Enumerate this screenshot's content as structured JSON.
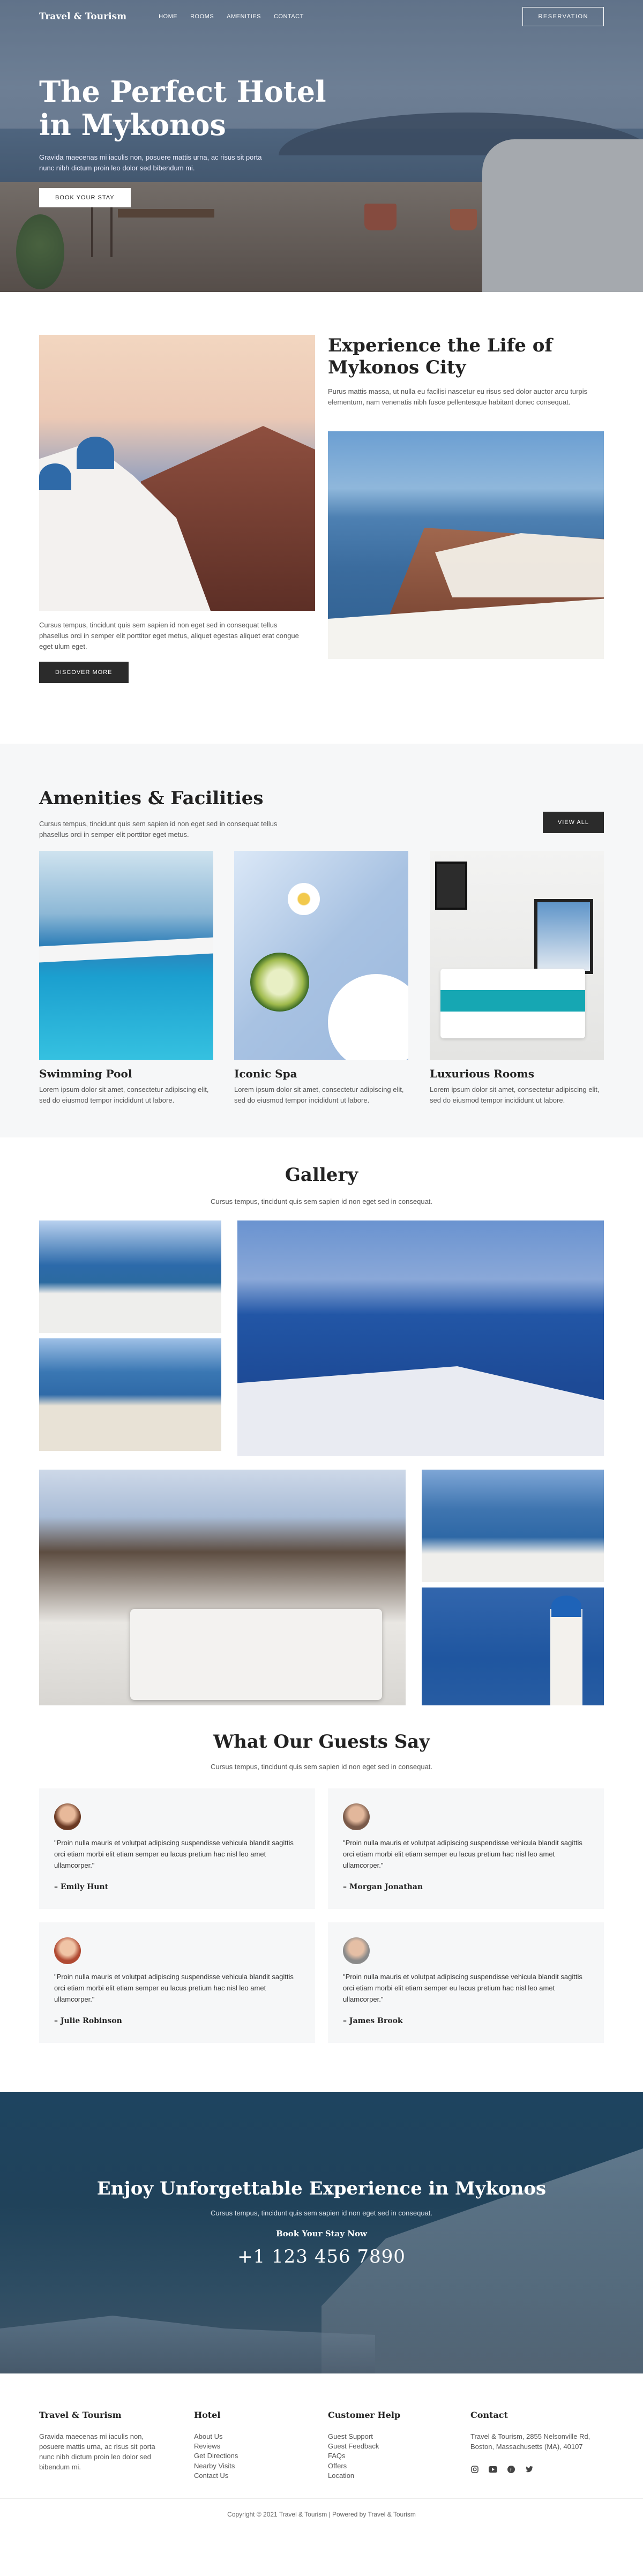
{
  "nav": {
    "logo": "Travel & Tourism",
    "links": [
      "HOME",
      "ROOMS",
      "AMENITIES",
      "CONTACT"
    ],
    "reservation": "RESERVATION"
  },
  "hero": {
    "title": "The Perfect Hotel in Mykonos",
    "text": "Gravida maecenas mi iaculis non, posuere mattis urna, ac risus sit porta nunc nibh dictum proin leo dolor sed bibendum mi.",
    "button": "BOOK YOUR STAY"
  },
  "experience": {
    "title": "Experience the Life of Mykonos City",
    "text": "Purus mattis massa, ut nulla eu facilisi nascetur eu risus sed dolor auctor arcu turpis elementum, nam venenatis nibh fusce pellentesque habitant donec consequat.",
    "text2": "Cursus tempus, tincidunt quis sem sapien id non eget sed in consequat tellus phasellus orci in semper elit porttitor eget metus, aliquet egestas aliquet erat congue eget ulum eget.",
    "button": "DISCOVER MORE"
  },
  "amenities": {
    "title": "Amenities & Facilities",
    "text": "Cursus tempus, tincidunt quis sem sapien id non eget sed in consequat tellus phasellus orci in semper elit porttitor eget metus.",
    "button": "VIEW ALL",
    "items": [
      {
        "title": "Swimming Pool",
        "text": "Lorem ipsum dolor sit amet, consectetur adipiscing elit, sed do eiusmod tempor incididunt ut labore."
      },
      {
        "title": "Iconic Spa",
        "text": "Lorem ipsum dolor sit amet, consectetur adipiscing elit, sed do eiusmod tempor incididunt ut labore."
      },
      {
        "title": "Luxurious Rooms",
        "text": "Lorem ipsum dolor sit amet, consectetur adipiscing elit, sed do eiusmod tempor incididunt ut labore."
      }
    ]
  },
  "gallery": {
    "title": "Gallery",
    "text": "Cursus tempus, tincidunt quis sem sapien id non eget sed in consequat."
  },
  "testimonials": {
    "title": "What Our Guests Say",
    "text": "Cursus tempus, tincidunt quis sem sapien id non eget sed in consequat.",
    "items": [
      {
        "quote": "\"Proin nulla mauris et volutpat adipiscing suspendisse vehicula blandit sagittis orci etiam morbi elit etiam semper eu lacus pretium hac nisl leo amet ullamcorper.\"",
        "name": "– Emily Hunt"
      },
      {
        "quote": "\"Proin nulla mauris et volutpat adipiscing suspendisse vehicula blandit sagittis orci etiam morbi elit etiam semper eu lacus pretium hac nisl leo amet ullamcorper.\"",
        "name": "– Morgan Jonathan"
      },
      {
        "quote": "\"Proin nulla mauris et volutpat adipiscing suspendisse vehicula blandit sagittis orci etiam morbi elit etiam semper eu lacus pretium hac nisl leo amet ullamcorper.\"",
        "name": "– Julie Robinson"
      },
      {
        "quote": "\"Proin nulla mauris et volutpat adipiscing suspendisse vehicula blandit sagittis orci etiam morbi elit etiam semper eu lacus pretium hac nisl leo amet ullamcorper.\"",
        "name": "– James Brook"
      }
    ]
  },
  "cta": {
    "title": "Enjoy Unforgettable Experience in Mykonos",
    "text": "Cursus tempus, tincidunt quis sem sapien id non eget sed in consequat.",
    "book": "Book Your Stay Now",
    "phone": "+1 123 456 7890"
  },
  "footer": {
    "brand": "Travel & Tourism",
    "brand_text": "Gravida maecenas mi iaculis non, posuere mattis urna, ac risus sit porta nunc nibh dictum proin leo dolor sed bibendum mi.",
    "hotel_title": "Hotel",
    "hotel_links": [
      "About Us",
      "Reviews",
      "Get Directions",
      "Nearby Visits",
      "Contact Us"
    ],
    "help_title": "Customer Help",
    "help_links": [
      "Guest Support",
      "Guest Feedback",
      "FAQs",
      "Offers",
      "Location"
    ],
    "contact_title": "Contact",
    "contact_text": "Travel & Tourism, 2855 Nelsonville Rd, Boston, Massachusetts (MA), 40107",
    "copyright": "Copyright © 2021 Travel & Tourism | Powered by Travel & Tourism"
  },
  "icons": [
    "instagram-icon",
    "youtube-icon",
    "facebook-icon",
    "twitter-icon"
  ]
}
